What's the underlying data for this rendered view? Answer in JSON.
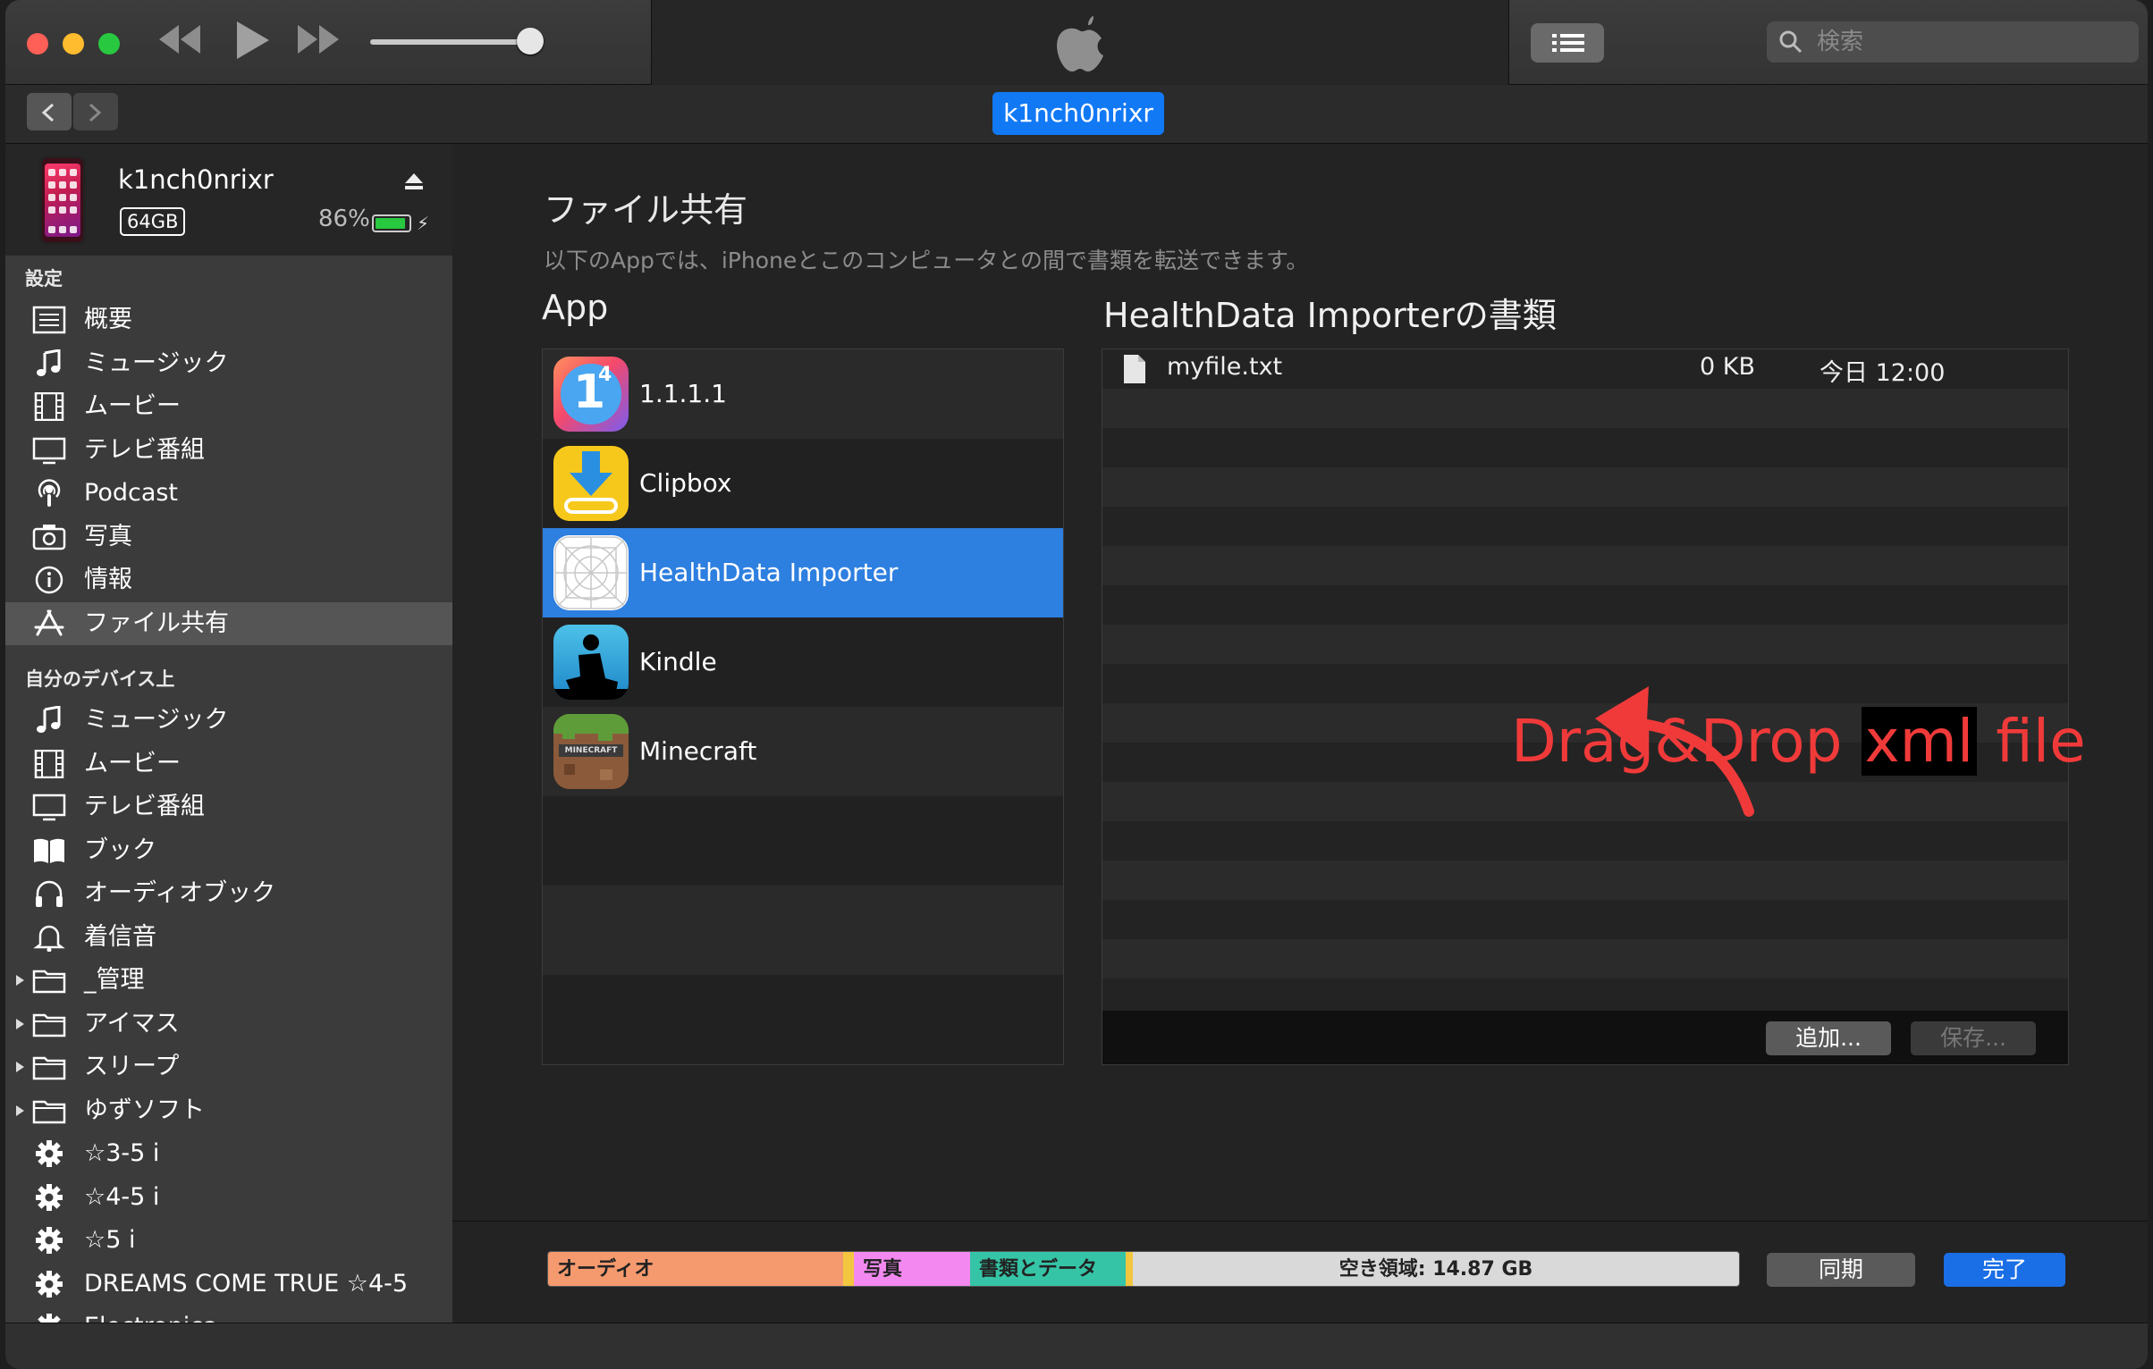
{
  "toolbar": {
    "search_placeholder": "検索",
    "device_tab": "k1nch0nrixr"
  },
  "device": {
    "name": "k1nch0nrixr",
    "capacity": "64GB",
    "battery_percent": "86%",
    "battery_level": 0.86
  },
  "sidebar": {
    "settings_header": "設定",
    "settings_items": [
      {
        "label": "概要",
        "icon": "summary-icon"
      },
      {
        "label": "ミュージック",
        "icon": "music-note-icon"
      },
      {
        "label": "ムービー",
        "icon": "film-icon"
      },
      {
        "label": "テレビ番組",
        "icon": "tv-icon"
      },
      {
        "label": "Podcast",
        "icon": "podcast-icon"
      },
      {
        "label": "写真",
        "icon": "camera-icon"
      },
      {
        "label": "情報",
        "icon": "info-icon"
      },
      {
        "label": "ファイル共有",
        "icon": "app-store-icon",
        "selected": true
      }
    ],
    "device_header": "自分のデバイス上",
    "device_items": [
      {
        "label": "ミュージック",
        "icon": "music-note-icon"
      },
      {
        "label": "ムービー",
        "icon": "film-icon"
      },
      {
        "label": "テレビ番組",
        "icon": "tv-icon"
      },
      {
        "label": "ブック",
        "icon": "book-icon"
      },
      {
        "label": "オーディオブック",
        "icon": "headphones-icon"
      },
      {
        "label": "着信音",
        "icon": "bell-icon"
      },
      {
        "label": "_管理",
        "icon": "folder-icon"
      },
      {
        "label": "アイマス",
        "icon": "folder-icon"
      },
      {
        "label": "スリープ",
        "icon": "folder-icon"
      },
      {
        "label": "ゆずソフト",
        "icon": "folder-icon"
      },
      {
        "label": "☆3-5 i",
        "icon": "gear-icon"
      },
      {
        "label": "☆4-5 i",
        "icon": "gear-icon"
      },
      {
        "label": "☆5 i",
        "icon": "gear-icon"
      },
      {
        "label": "DREAMS COME TRUE ☆4-5",
        "icon": "gear-icon"
      },
      {
        "label": "Electronica",
        "icon": "gear-icon"
      }
    ]
  },
  "main": {
    "title": "ファイル共有",
    "subtitle": "以下のAppでは、iPhoneとこのコンピュータとの間で書類を転送できます。",
    "apps_header": "App",
    "apps": [
      {
        "name": "1.1.1.1",
        "icon": "cloudflare-1111-icon"
      },
      {
        "name": "Clipbox",
        "icon": "clipbox-icon"
      },
      {
        "name": "HealthData Importer",
        "icon": "healthdata-importer-icon",
        "selected": true
      },
      {
        "name": "Kindle",
        "icon": "kindle-icon"
      },
      {
        "name": "Minecraft",
        "icon": "minecraft-icon"
      }
    ],
    "files_header": "HealthData Importerの書類",
    "files": [
      {
        "name": "myfile.txt",
        "size": "0 KB",
        "date": "今日 12:00"
      }
    ],
    "add_button": "追加...",
    "save_button": "保存...",
    "annotation_part1": "Drag&Drop ",
    "annotation_part2": "xml",
    "annotation_part3": " file",
    "annotation_color": "#f03a3a"
  },
  "capacity_bar": [
    {
      "label": "オーディオ",
      "color": "#f59a6e"
    },
    {
      "label": "",
      "color": "#f3c640"
    },
    {
      "label": "写真",
      "color": "#f389f0"
    },
    {
      "label": "書類とデータ",
      "color": "#35c4a6"
    },
    {
      "label": "",
      "color": "#f3c640"
    },
    {
      "label": "空き領域: 14.87 GB",
      "color": "#d9d9d9"
    }
  ],
  "footer": {
    "sync_button": "同期",
    "done_button": "完了"
  }
}
